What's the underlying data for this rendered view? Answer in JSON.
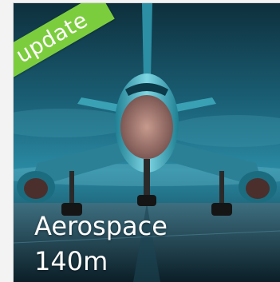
{
  "tile": {
    "badge": "update",
    "title": "Aerospace",
    "value": "140m"
  },
  "colors": {
    "badge_green": "#7ccd3e",
    "text": "#ffffff",
    "sky": "#1e6f86"
  }
}
